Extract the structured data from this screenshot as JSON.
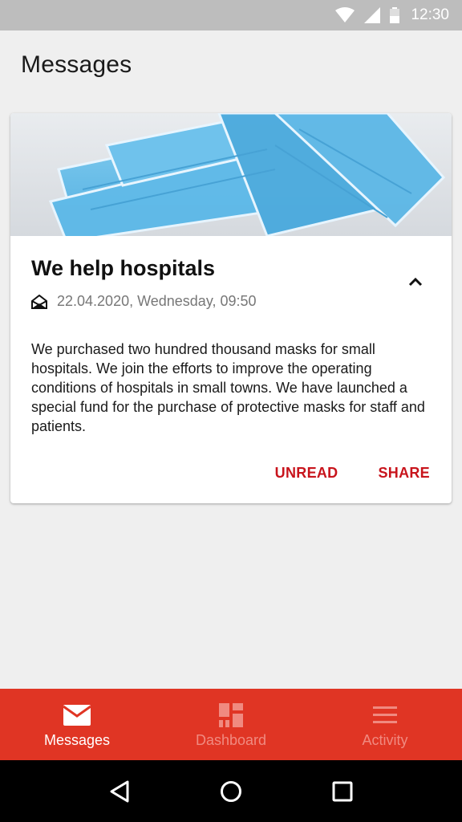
{
  "status_bar": {
    "time": "12:30"
  },
  "header": {
    "title": "Messages"
  },
  "message": {
    "title": "We help hospitals",
    "date": "22.04.2020, Wednesday, 09:50",
    "body": "We purchased two hundred thousand masks for small hospitals. We join the efforts to improve the operating conditions of hospitals in small towns. We have launched a special fund for the purchase of protective masks for staff and patients.",
    "actions": {
      "unread": "UNREAD",
      "share": "SHARE"
    },
    "image_icon": "surgical-masks-photo"
  },
  "bottom_nav": {
    "items": [
      {
        "label": "Messages",
        "icon": "envelope-icon",
        "active": true
      },
      {
        "label": "Dashboard",
        "icon": "dashboard-icon",
        "active": false
      },
      {
        "label": "Activity",
        "icon": "menu-icon",
        "active": false
      }
    ]
  },
  "colors": {
    "accent": "#e03524",
    "action_text": "#c8141c",
    "inactive_nav": "#f08a80"
  }
}
